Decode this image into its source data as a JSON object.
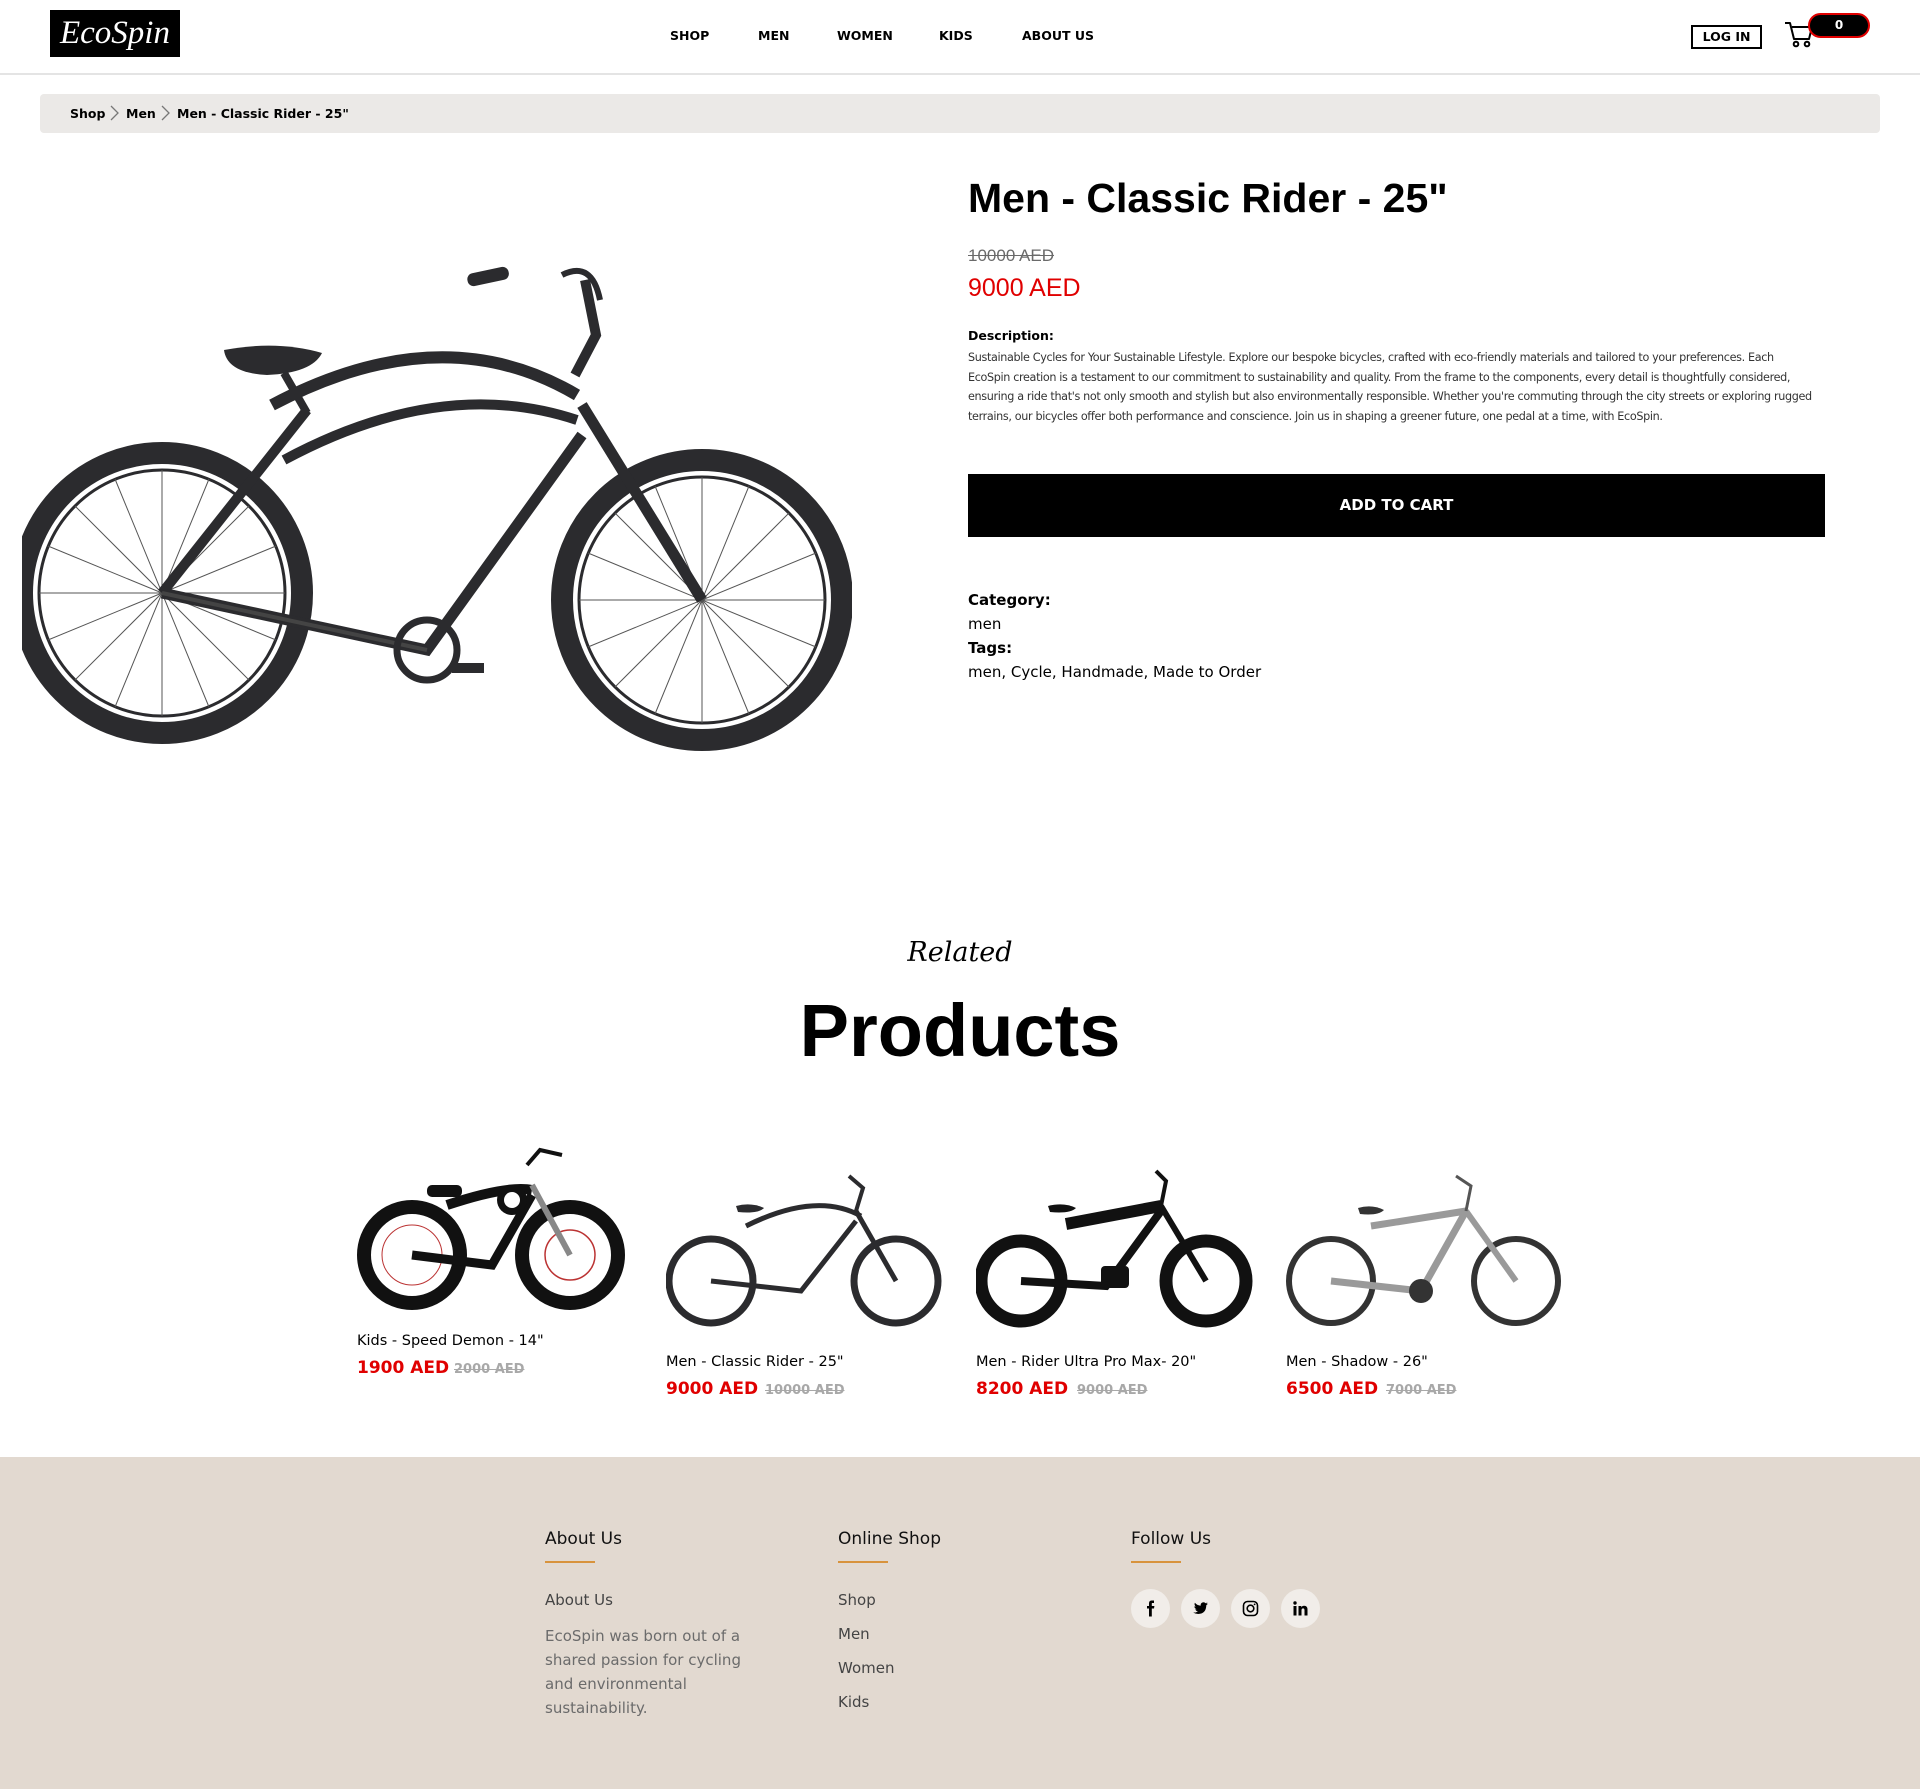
{
  "header": {
    "logo": "EcoSpin",
    "nav": [
      "SHOP",
      "MEN",
      "WOMEN",
      "KIDS",
      "ABOUT US"
    ],
    "login_label": "LOG IN",
    "cart_count": "0"
  },
  "breadcrumb": [
    "Shop",
    "Men",
    "Men - Classic Rider - 25\""
  ],
  "product": {
    "title": "Men - Classic Rider - 25\"",
    "old_price": "10000 AED",
    "price": "9000 AED",
    "description_label": "Description:",
    "description": "Sustainable Cycles for Your Sustainable Lifestyle. Explore our bespoke bicycles, crafted with eco-friendly materials and tailored to your preferences. Each EcoSpin creation is a testament to our commitment to sustainability and quality. From the frame to the components, every detail is thoughtfully considered, ensuring a ride that's not only smooth and stylish but also environmentally responsible. Whether you're commuting through the city streets or exploring rugged terrains, our bicycles offer both performance and conscience. Join us in shaping a greener future, one pedal at a time, with EcoSpin.",
    "add_to_cart": "ADD TO CART",
    "category_label": "Category:",
    "category": "men",
    "tags_label": "Tags:",
    "tags": "men, Cycle, Handmade, Made to Order",
    "image_icon": "black-cruiser-bicycle"
  },
  "related": {
    "script_label": "Related",
    "title": "Products",
    "items": [
      {
        "name": "Kids - Speed Demon - 14\"",
        "price": "1900 AED",
        "old_price": "2000 AED",
        "image_icon": "kids-bicycle"
      },
      {
        "name": "Men - Classic Rider - 25\"",
        "price": "9000 AED",
        "old_price": "10000 AED",
        "image_icon": "cruiser-bicycle"
      },
      {
        "name": "Men - Rider Ultra Pro Max- 20\"",
        "price": "8200 AED",
        "old_price": "9000 AED",
        "image_icon": "electric-bicycle"
      },
      {
        "name": "Men - Shadow - 26\"",
        "price": "6500 AED",
        "old_price": "7000 AED",
        "image_icon": "grey-bicycle"
      }
    ]
  },
  "footer": {
    "about": {
      "heading": "About Us",
      "link": "About Us",
      "text": "EcoSpin was born out of a shared passion for cycling and environmental sustainability."
    },
    "shop": {
      "heading": "Online Shop",
      "links": [
        "Shop",
        "Men",
        "Women",
        "Kids"
      ]
    },
    "follow": {
      "heading": "Follow Us",
      "icons": [
        "facebook-icon",
        "twitter-icon",
        "instagram-icon",
        "linkedin-icon"
      ]
    }
  },
  "colors": {
    "accent_red": "#e00000",
    "breadcrumb_bg": "#ebe9e7",
    "footer_bg": "#e2d9d0",
    "footer_underline": "#d8933c"
  }
}
